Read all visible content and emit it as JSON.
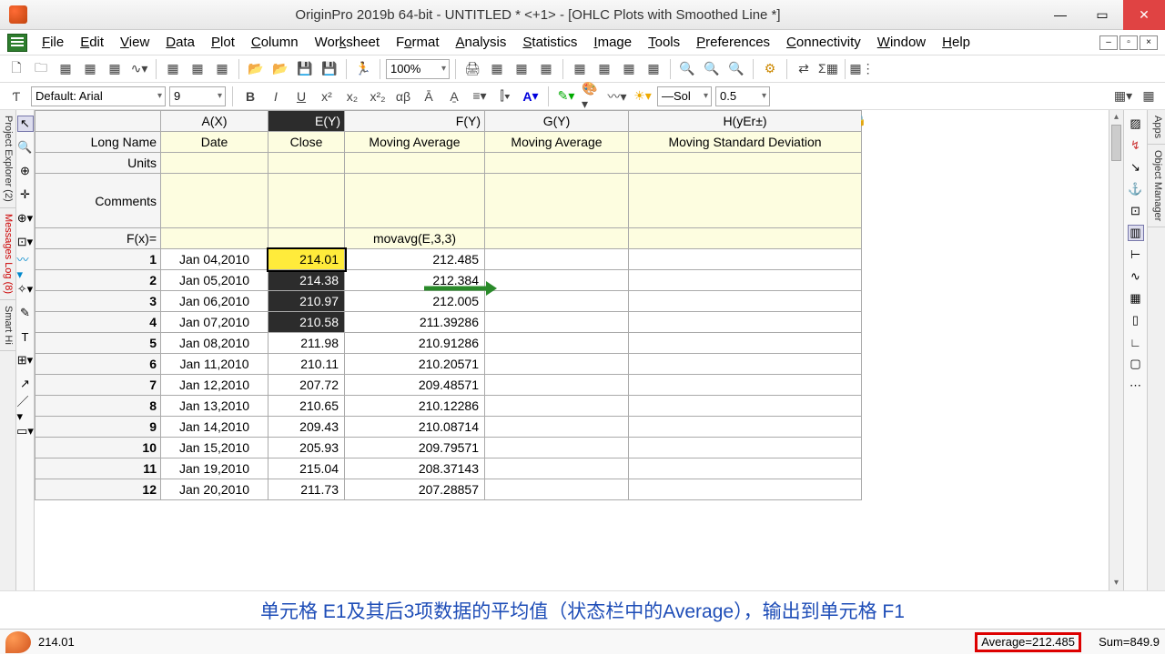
{
  "title": "OriginPro 2019b 64-bit - UNTITLED * <+1> - [OHLC Plots with Smoothed Line *]",
  "menus": [
    "File",
    "Edit",
    "View",
    "Data",
    "Plot",
    "Column",
    "Worksheet",
    "Format",
    "Analysis",
    "Statistics",
    "Image",
    "Tools",
    "Preferences",
    "Connectivity",
    "Window",
    "Help"
  ],
  "font": {
    "name": "Default: Arial",
    "size": "9"
  },
  "zoom": "100%",
  "linestyle": "Sol",
  "linewidth": "0.5",
  "leftTabs": [
    "Project Explorer (2)",
    "Messages Log (8)",
    "Smart Hi"
  ],
  "rightTabs": [
    "Apps",
    "Object Manager"
  ],
  "columns": {
    "A": {
      "hdr": "A(X)",
      "long": "Date"
    },
    "E": {
      "hdr": "E(Y)",
      "long": "Close"
    },
    "F": {
      "hdr": "F(Y)",
      "long": "Moving Average",
      "fx": "movavg(E,3,3)"
    },
    "G": {
      "hdr": "G(Y)",
      "long": "Moving Average"
    },
    "H": {
      "hdr": "H(yEr±)",
      "long": "Moving Standard Deviation"
    }
  },
  "rowLabels": {
    "long": "Long Name",
    "units": "Units",
    "comments": "Comments",
    "fx": "F(x)="
  },
  "rows": [
    {
      "n": "1",
      "A": "Jan 04,2010",
      "E": "214.01",
      "F": "212.485"
    },
    {
      "n": "2",
      "A": "Jan 05,2010",
      "E": "214.38",
      "F": "212.384"
    },
    {
      "n": "3",
      "A": "Jan 06,2010",
      "E": "210.97",
      "F": "212.005"
    },
    {
      "n": "4",
      "A": "Jan 07,2010",
      "E": "210.58",
      "F": "211.39286"
    },
    {
      "n": "5",
      "A": "Jan 08,2010",
      "E": "211.98",
      "F": "210.91286"
    },
    {
      "n": "6",
      "A": "Jan 11,2010",
      "E": "210.11",
      "F": "210.20571"
    },
    {
      "n": "7",
      "A": "Jan 12,2010",
      "E": "207.72",
      "F": "209.48571"
    },
    {
      "n": "8",
      "A": "Jan 13,2010",
      "E": "210.65",
      "F": "210.12286"
    },
    {
      "n": "9",
      "A": "Jan 14,2010",
      "E": "209.43",
      "F": "210.08714"
    },
    {
      "n": "10",
      "A": "Jan 15,2010",
      "E": "205.93",
      "F": "209.79571"
    },
    {
      "n": "11",
      "A": "Jan 19,2010",
      "E": "215.04",
      "F": "208.37143"
    },
    {
      "n": "12",
      "A": "Jan 20,2010",
      "E": "211.73",
      "F": "207.28857"
    }
  ],
  "caption": "单元格 E1及其后3项数据的平均值（状态栏中的Average），输出到单元格 F1",
  "status": {
    "val": "214.01",
    "avg": "Average=212.485",
    "sum": "Sum=849.9"
  }
}
